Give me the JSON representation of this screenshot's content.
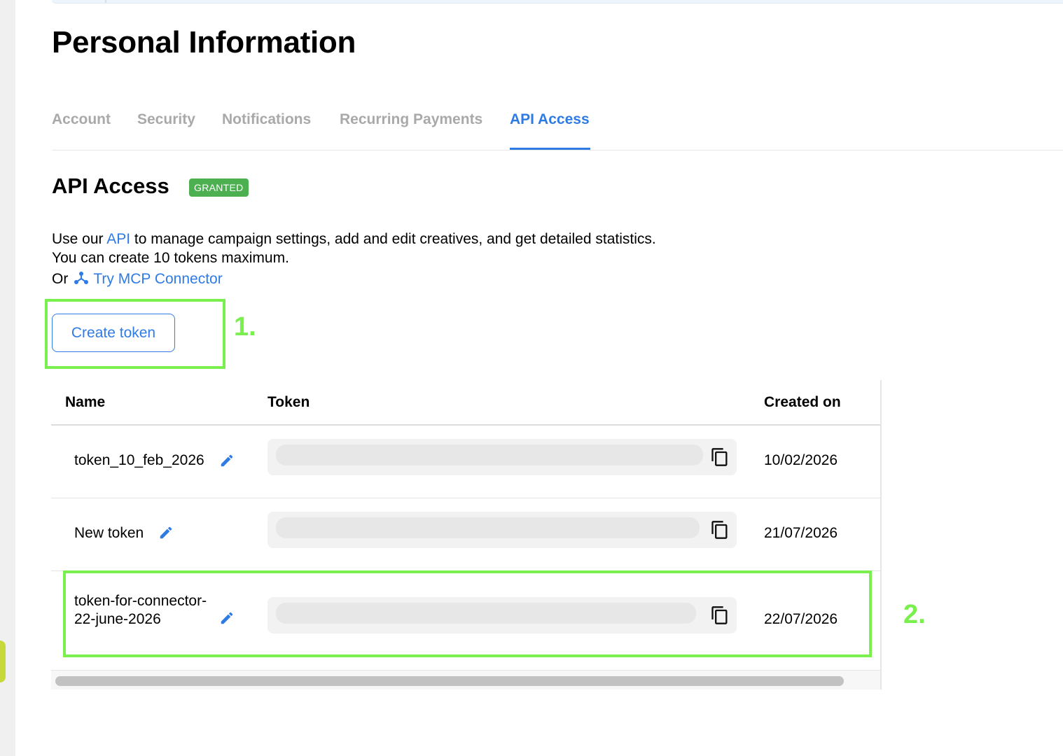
{
  "page": {
    "title": "Personal Information"
  },
  "tabs": [
    {
      "label": "Account"
    },
    {
      "label": "Security"
    },
    {
      "label": "Notifications"
    },
    {
      "label": "Recurring Payments"
    },
    {
      "label": "API Access"
    }
  ],
  "active_tab": "API Access",
  "section": {
    "title": "API Access",
    "badge": "GRANTED",
    "desc_prefix": "Use our",
    "desc_link": "API",
    "desc_suffix": "to manage campaign settings, add and edit creatives, and get detailed statistics.",
    "limit_text": "You can create 10 tokens maximum.",
    "or_text": "Or",
    "mcp_link": "Try MCP Connector",
    "create_button": "Create token"
  },
  "table": {
    "headers": {
      "name": "Name",
      "token": "Token",
      "created": "Created on"
    },
    "rows": [
      {
        "name": "token_10_feb_2026",
        "created": "10/02/2026"
      },
      {
        "name": "New token",
        "created": "21/07/2026"
      },
      {
        "name": "token-for-connector-22-june-2026",
        "created": "22/07/2026"
      }
    ]
  },
  "annotations": {
    "label_1": "1.",
    "label_2": "2."
  },
  "colors": {
    "accent": "#2f7be5",
    "badge": "#4caf50",
    "annotation": "#79f04e"
  }
}
